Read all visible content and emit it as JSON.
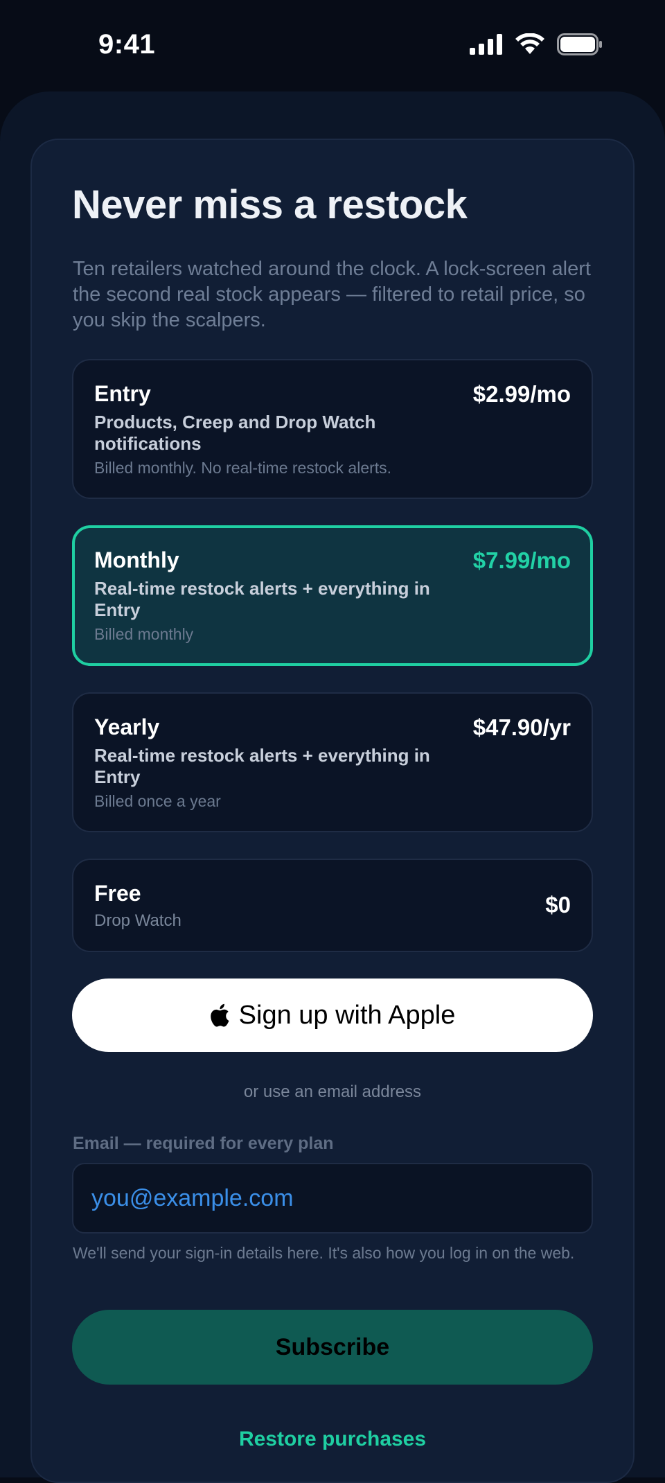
{
  "status_bar": {
    "time": "9:41",
    "icons": [
      "cellular-signal-icon",
      "wifi-icon",
      "battery-icon"
    ]
  },
  "header": {
    "title": "Never miss a restock",
    "subtitle": "Ten retailers watched around the clock. A lock-screen alert the second real stock appears — filtered to retail price, so you skip the scalpers."
  },
  "plans": [
    {
      "name": "Entry",
      "price": "$2.99/mo",
      "description": "Products, Creep and Drop Watch notifications",
      "billing": "Billed monthly. No real-time restock alerts.",
      "selected": false
    },
    {
      "name": "Monthly",
      "price": "$7.99/mo",
      "description": "Real-time restock alerts + everything in Entry",
      "billing": "Billed monthly",
      "selected": true
    },
    {
      "name": "Yearly",
      "price": "$47.90/yr",
      "description": "Real-time restock alerts + everything in Entry",
      "billing": "Billed once a year",
      "selected": false
    },
    {
      "name": "Free",
      "price": "$0",
      "description": "Drop Watch",
      "selected": false
    }
  ],
  "apple_button": {
    "icon": "apple-logo-icon",
    "label": "Sign up with Apple"
  },
  "divider_text": "or use an email address",
  "email": {
    "label": "Email — required for every plan",
    "placeholder": "you@example.com",
    "value": "",
    "help": "We'll send your sign-in details here. It's also how you log in on the web."
  },
  "subscribe_button": {
    "label": "Subscribe"
  },
  "restore_link": {
    "label": "Restore purchases"
  },
  "colors": {
    "accent": "#1fcfa2",
    "background": "#070c17",
    "card": "#111e35",
    "selected_plan_bg": "#0f3441",
    "subscribe_bg": "#0f5a52",
    "email_text": "#3b8fe8"
  }
}
